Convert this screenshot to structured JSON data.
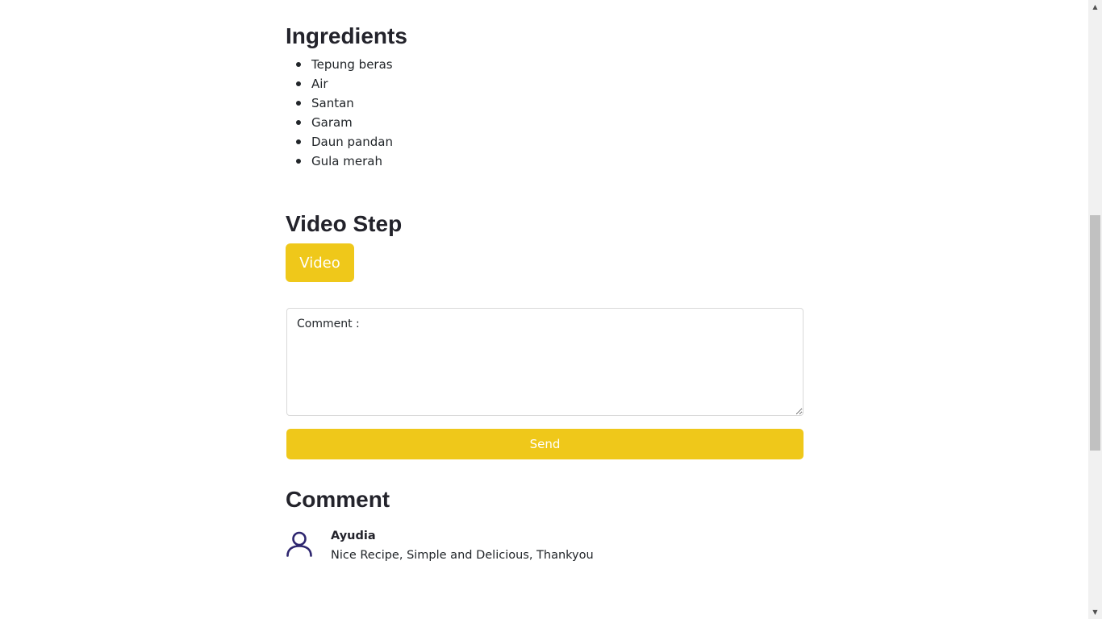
{
  "ingredients": {
    "title": "Ingredients",
    "items": [
      "Tepung beras",
      "Air",
      "Santan",
      "Garam",
      "Daun pandan",
      "Gula merah"
    ]
  },
  "video_step": {
    "title": "Video Step",
    "button_label": "Video"
  },
  "comment_form": {
    "placeholder": "Comment :",
    "value": "",
    "send_label": "Send"
  },
  "comments": {
    "title": "Comment",
    "items": [
      {
        "author": "Ayudia",
        "text": "Nice Recipe, Simple and Delicious, Thankyou",
        "icon": "user-icon"
      }
    ]
  },
  "colors": {
    "accent": "#efc81a",
    "heading": "#23232b",
    "avatar_stroke": "#2e266f"
  },
  "scrollbar": {
    "up_icon": "▲",
    "down_icon": "▼"
  }
}
